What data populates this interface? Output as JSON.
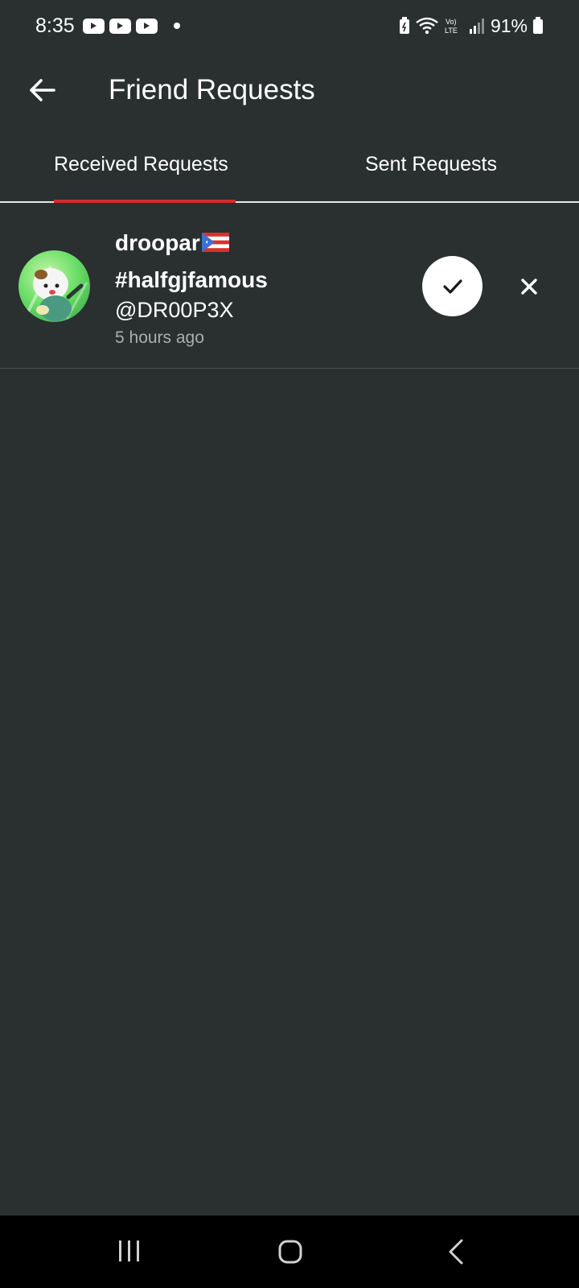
{
  "status_bar": {
    "time": "8:35",
    "notification_icons": [
      "youtube-icon",
      "youtube-icon",
      "youtube-icon"
    ],
    "battery_percent": "91%",
    "network_label": "LTE"
  },
  "app_bar": {
    "title": "Friend Requests",
    "back_icon": "arrow-left-icon"
  },
  "tabs": [
    {
      "label": "Received Requests",
      "selected": true
    },
    {
      "label": "Sent Requests",
      "selected": false
    }
  ],
  "accent_color": "#d42a2a",
  "requests": [
    {
      "display_name_line1": "droopar",
      "display_name_line2": "#halfgjfamous",
      "flag_icon": "puerto-rico-flag-icon",
      "handle": "@DR00P3X",
      "time_ago": "5 hours ago",
      "accept_icon": "check-icon",
      "decline_icon": "close-icon"
    }
  ],
  "nav_bar": {
    "icons": [
      "recents-icon",
      "home-icon",
      "back-icon"
    ]
  }
}
